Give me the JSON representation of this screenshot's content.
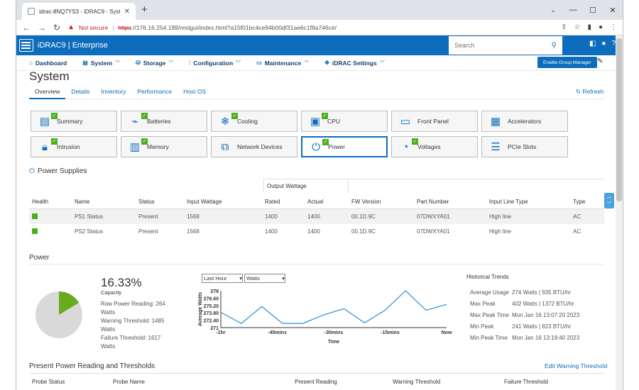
{
  "browser": {
    "tab_title": "idrac-8NQ7YS3 - iDRAC9 - Syste",
    "not_secure": "Not secure",
    "url_scheme": "https",
    "url_rest": "://176.16.254.189/restgui/index.html?a15f01bc4ce94b00df31ae6c1f8a746c#/"
  },
  "header": {
    "brand": "iDRAC9 | Enterprise",
    "search_placeholder": "Search"
  },
  "nav": {
    "items": [
      {
        "label": "Dashboard",
        "dropdown": false
      },
      {
        "label": "System",
        "dropdown": true
      },
      {
        "label": "Storage",
        "dropdown": true
      },
      {
        "label": "Configuration",
        "dropdown": true
      },
      {
        "label": "Maintenance",
        "dropdown": true
      },
      {
        "label": "iDRAC Settings",
        "dropdown": true
      }
    ],
    "group_manager": "Enable Group Manager"
  },
  "page": {
    "title": "System",
    "subtabs": [
      "Overview",
      "Details",
      "Inventory",
      "Performance",
      "Host OS"
    ],
    "refresh": "Refresh"
  },
  "tiles": [
    {
      "label": "Summary",
      "icon": "summary-icon",
      "ok": true
    },
    {
      "label": "Batteries",
      "icon": "battery-icon",
      "ok": true
    },
    {
      "label": "Cooling",
      "icon": "snowflake-icon",
      "ok": true
    },
    {
      "label": "CPU",
      "icon": "cpu-icon",
      "ok": true
    },
    {
      "label": "Front Panel",
      "icon": "front-panel-icon",
      "ok": false
    },
    {
      "label": "Accelerators",
      "icon": "accelerator-icon",
      "ok": false
    },
    {
      "label": "Intrusion",
      "icon": "lock-icon",
      "ok": true
    },
    {
      "label": "Memory",
      "icon": "memory-icon",
      "ok": true
    },
    {
      "label": "Network Devices",
      "icon": "network-icon",
      "ok": false
    },
    {
      "label": "Power",
      "icon": "plug-icon",
      "ok": true,
      "selected": true
    },
    {
      "label": "Voltages",
      "icon": "gauge-icon",
      "ok": true
    },
    {
      "label": "PCIe Slots",
      "icon": "pcie-icon",
      "ok": false
    }
  ],
  "power_supplies": {
    "title": "Power Supplies",
    "group_header": "Output Wattage",
    "columns": [
      "Health",
      "Name",
      "Status",
      "Input Wattage",
      "Rated",
      "Actual",
      "FW Version",
      "Part Number",
      "Input Line Type",
      "Type"
    ],
    "rows": [
      [
        "ok",
        "PS1 Status",
        "Present",
        "1568",
        "1400",
        "1400",
        "00.1D.9C",
        "07DWXYA01",
        "High line",
        "AC"
      ],
      [
        "ok",
        "PS2 Status",
        "Present",
        "1568",
        "1400",
        "1400",
        "00.1D.9C",
        "07DWXYA01",
        "High line",
        "AC"
      ]
    ]
  },
  "power": {
    "title": "Power",
    "capacity_pct": "16.33%",
    "capacity_value": 16.33,
    "capacity_label": "Capacity",
    "raw": "Raw Power Reading: 264 Watts",
    "warning": "Warning Threshold: 1485 Watts",
    "failure": "Failure Threshold: 1617 Watts",
    "range_select": "Last Hour",
    "unit_select": "Watts"
  },
  "chart_data": {
    "type": "line",
    "ylabel": "Average Watts",
    "xlabel": "Time",
    "y_ticks": [
      "278",
      "276.60",
      "275.20",
      "273.80",
      "272.40",
      "271"
    ],
    "ylim": [
      271,
      278
    ],
    "x_ticks": [
      "-1hr",
      "-45mins",
      "-30mins",
      "-15mins",
      "Now"
    ],
    "series": [
      {
        "values": [
          273.9,
          271.8,
          275.0,
          271.8,
          271.8,
          273.4,
          274.6,
          271.9,
          274.3,
          278.0,
          274.3,
          275.4
        ]
      }
    ]
  },
  "trends": {
    "title": "Historical Trends",
    "rows": [
      {
        "label": "Average Usage",
        "value": "274 Watts | 935 BTU/hr"
      },
      {
        "label": "Max Peak",
        "value": "402 Watts | 1372 BTU/hr"
      },
      {
        "label": "Max Peak Time",
        "value": "Mon Jan 16 13:07:20 2023"
      },
      {
        "label": "Min Peak",
        "value": "241 Watts | 823 BTU/hr"
      },
      {
        "label": "Min Peak Time",
        "value": "Mon Jan 16 13:19:40 2023"
      }
    ]
  },
  "thresholds": {
    "title": "Present Power Reading and Thresholds",
    "edit": "Edit Warning Threshold",
    "columns": [
      "Probe Status",
      "Probe Name",
      "Present Reading",
      "Warning Threshold",
      "Failure Threshold"
    ]
  },
  "colors": {
    "accent": "#0d6dbc",
    "ok": "#4caf1e",
    "pie_fill": "#6aaa1e",
    "pie_bg": "#d9d9d9"
  }
}
